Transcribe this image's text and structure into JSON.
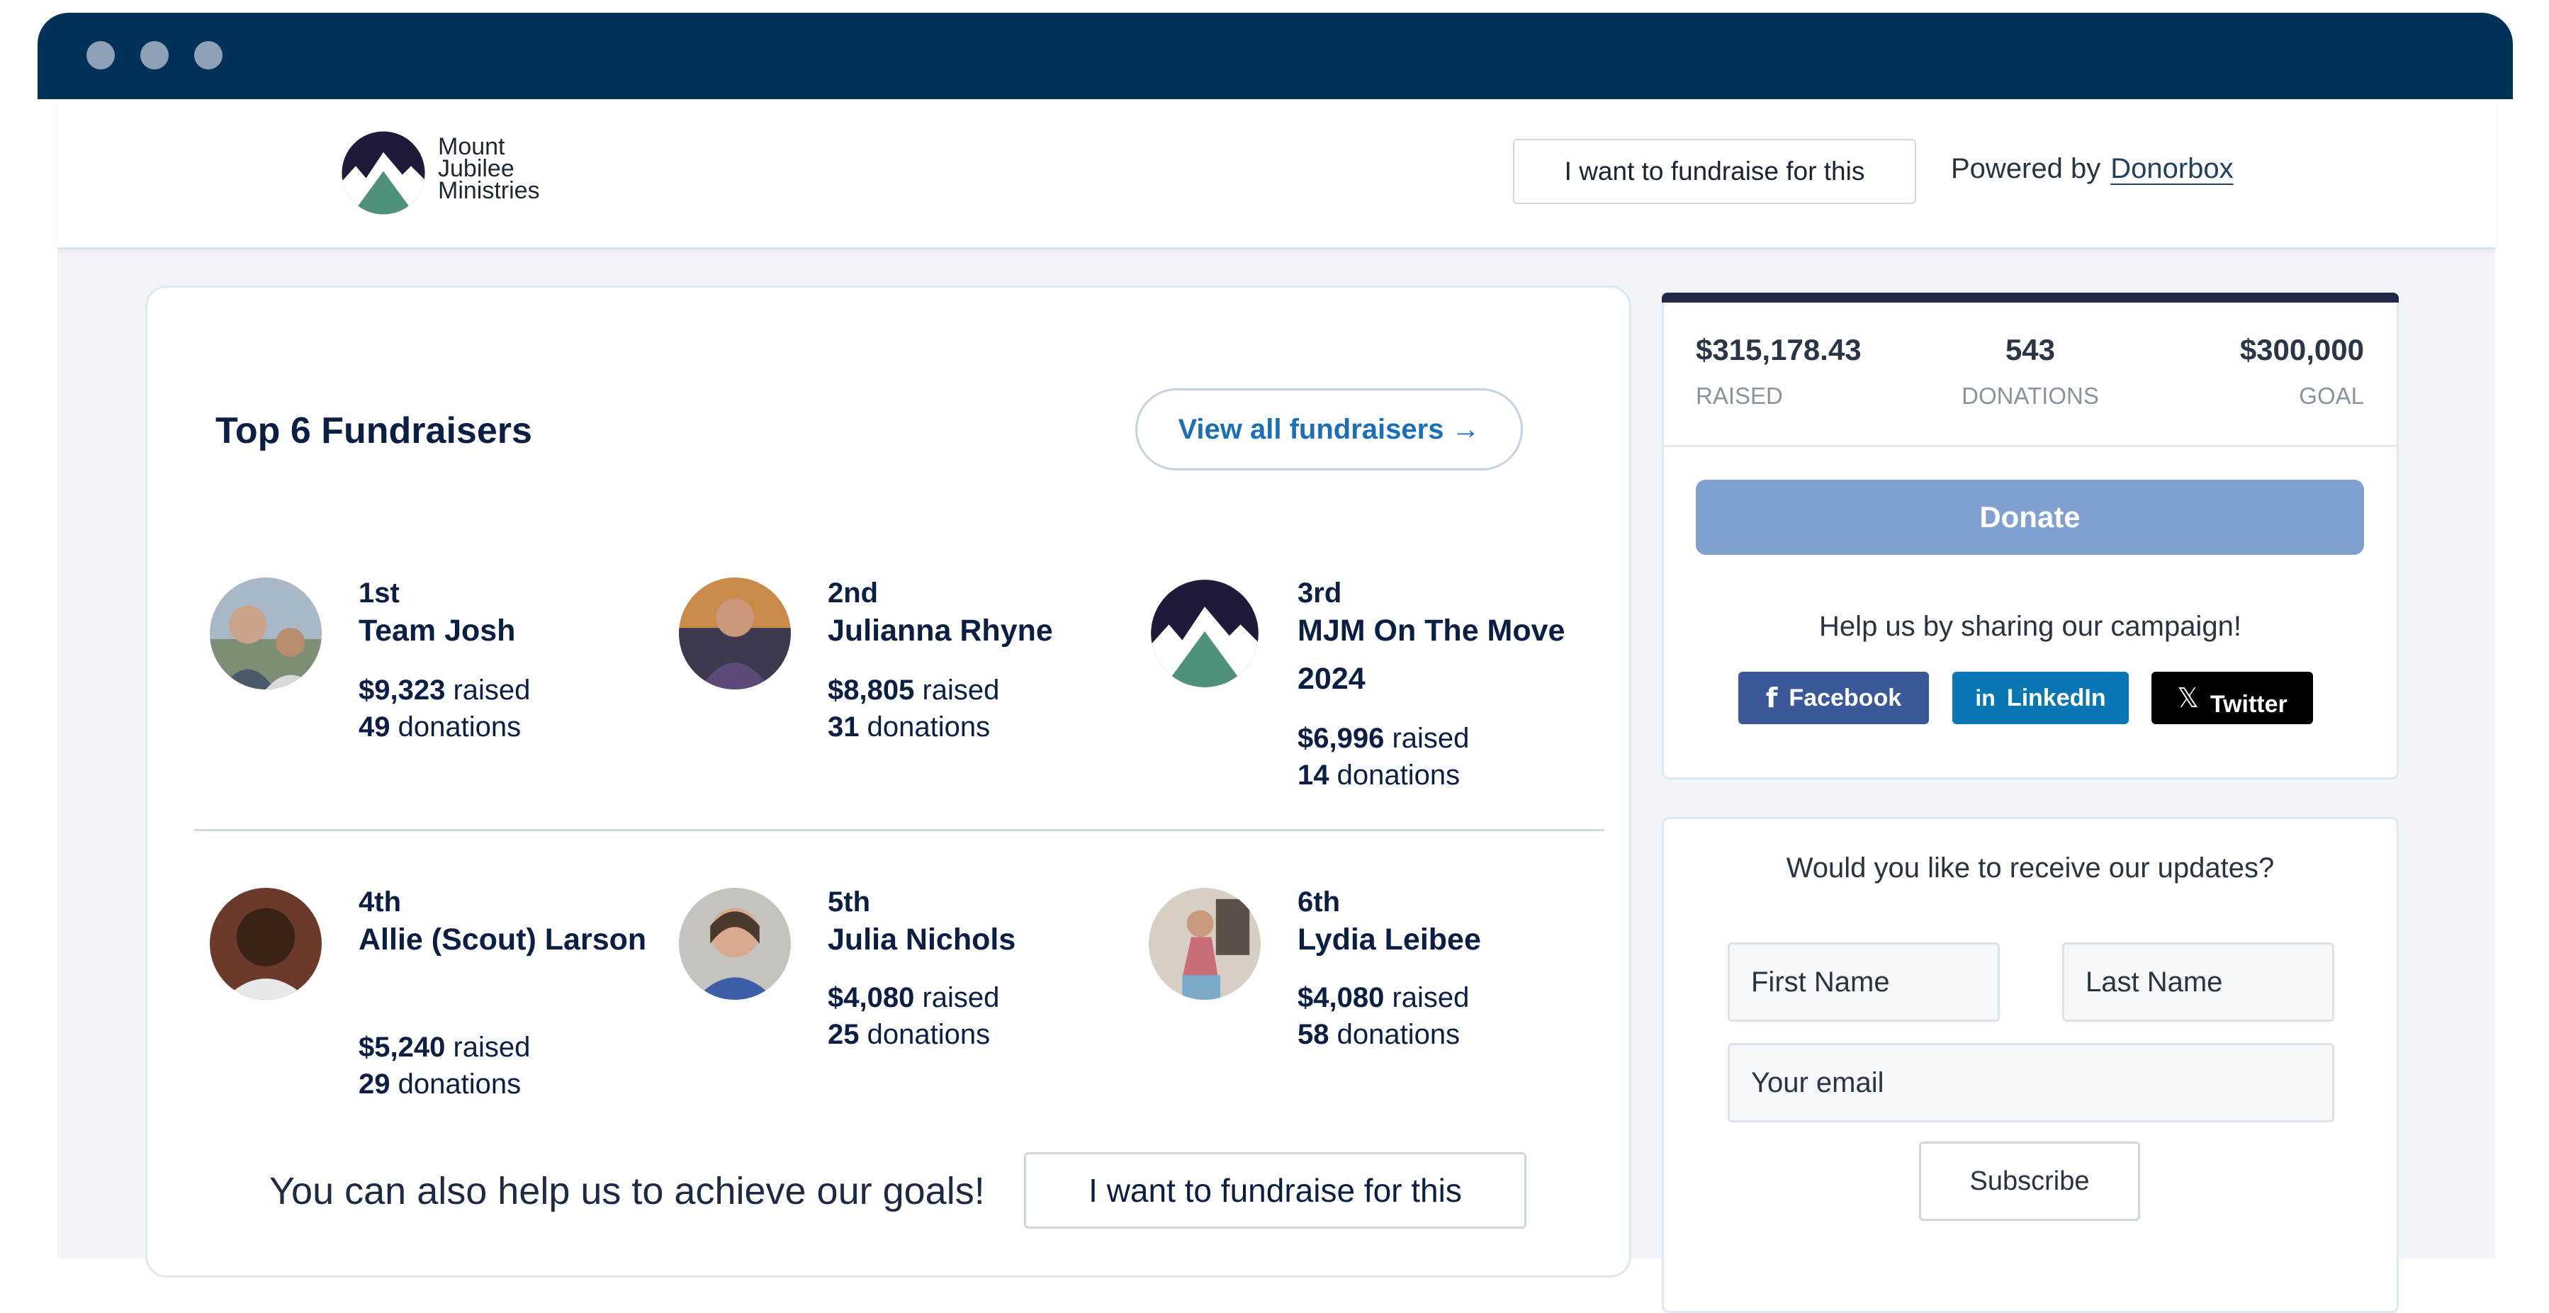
{
  "header": {
    "org_logo_lines": [
      "Mount",
      "Jubilee",
      "Ministries"
    ],
    "fundraise_button": "I want to fundraise for this",
    "powered_by": "Powered by",
    "powered_link": "Donorbox"
  },
  "main": {
    "title": "Top 6 Fundraisers",
    "view_all": "View all fundraisers →",
    "fundraisers": [
      {
        "rank": "1st",
        "name": "Team Josh",
        "amount": "$9,323",
        "raised_label": " raised",
        "donations": "49",
        "donations_label": " donations"
      },
      {
        "rank": "2nd",
        "name": "Julianna Rhyne",
        "amount": "$8,805",
        "raised_label": " raised",
        "donations": "31",
        "donations_label": " donations"
      },
      {
        "rank": "3rd",
        "name": "MJM On The Move 2024",
        "amount": "$6,996",
        "raised_label": " raised",
        "donations": "14",
        "donations_label": " donations"
      },
      {
        "rank": "4th",
        "name": "Allie (Scout) Larson",
        "amount": "$5,240",
        "raised_label": " raised",
        "donations": "29",
        "donations_label": " donations"
      },
      {
        "rank": "5th",
        "name": "Julia Nichols",
        "amount": "$4,080",
        "raised_label": " raised",
        "donations": "25",
        "donations_label": " donations"
      },
      {
        "rank": "6th",
        "name": "Lydia Leibee",
        "amount": "$4,080",
        "raised_label": " raised",
        "donations": "58",
        "donations_label": " donations"
      }
    ],
    "also_help": "You can also help us to achieve our goals!",
    "fundraise_button": "I want to fundraise for this"
  },
  "sidebar": {
    "stats": [
      {
        "value": "$315,178.43",
        "label": "RAISED"
      },
      {
        "value": "543",
        "label": "DONATIONS"
      },
      {
        "value": "$300,000",
        "label": "GOAL"
      }
    ],
    "donate": "Donate",
    "share_text": "Help us by sharing our campaign!",
    "social": {
      "facebook": "Facebook",
      "linkedin": "LinkedIn",
      "twitter": "Twitter"
    },
    "updates_question": "Would you like to receive our updates?",
    "first_name_placeholder": "First Name",
    "last_name_placeholder": "Last Name",
    "email_placeholder": "Your email",
    "subscribe": "Subscribe"
  },
  "colors": {
    "titlebar": "#023158",
    "accent_link": "#1b6fb8",
    "donate_button": "#80a0d0",
    "facebook": "#3b5998",
    "linkedin": "#0a77b5",
    "twitter": "#000000",
    "logo_dark": "#1e1a3a",
    "logo_green": "#4f917d"
  }
}
